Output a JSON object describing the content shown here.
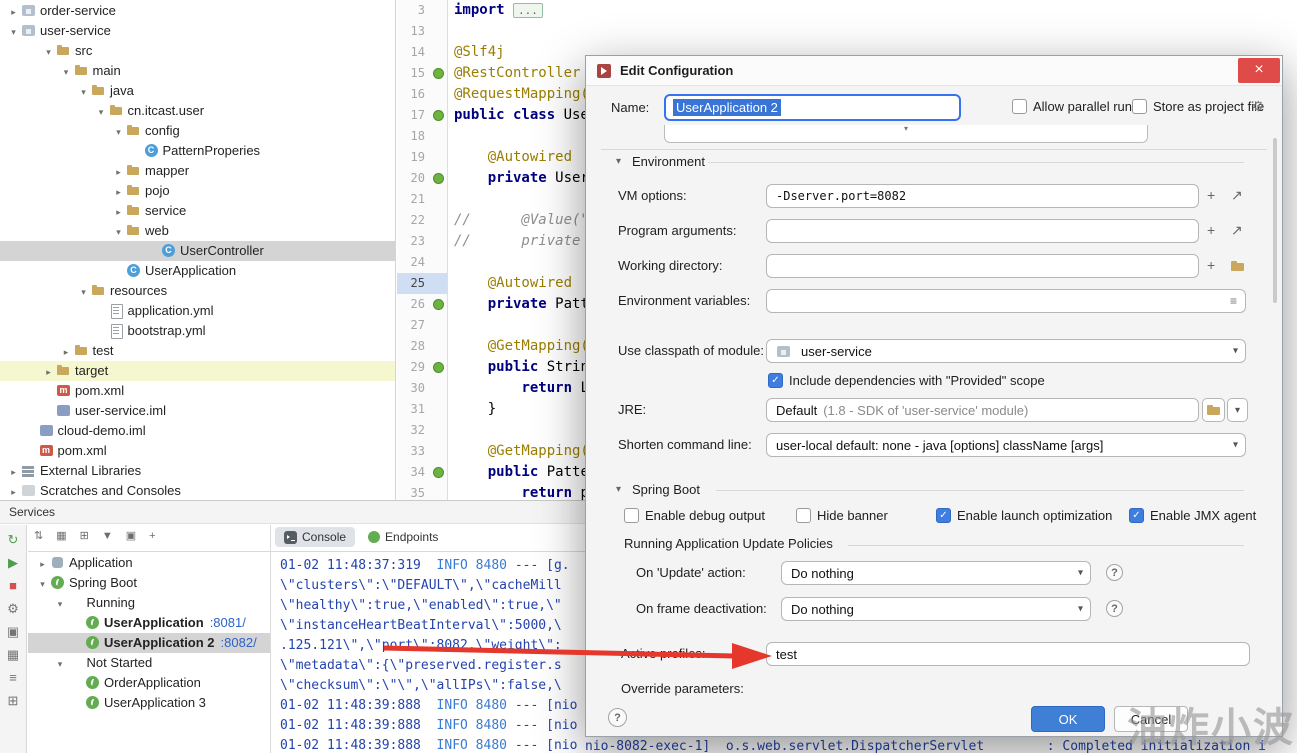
{
  "watermark": "油炸小波",
  "project_tree": {
    "items": [
      {
        "depth": 0,
        "chevron": ">",
        "icon": "module",
        "label": "order-service"
      },
      {
        "depth": 0,
        "chevron": "v",
        "icon": "module",
        "label": "user-service"
      },
      {
        "depth": 2,
        "chevron": "v",
        "icon": "folder",
        "label": "src"
      },
      {
        "depth": 3,
        "chevron": "v",
        "icon": "folder",
        "label": "main"
      },
      {
        "depth": 4,
        "chevron": "v",
        "icon": "folder",
        "label": "java"
      },
      {
        "depth": 5,
        "chevron": "v",
        "icon": "package",
        "label": "cn.itcast.user"
      },
      {
        "depth": 6,
        "chevron": "v",
        "icon": "folder",
        "label": "config"
      },
      {
        "depth": 7,
        "chevron": "",
        "icon": "class",
        "label": "PatternProperies"
      },
      {
        "depth": 6,
        "chevron": ">",
        "icon": "folder",
        "label": "mapper"
      },
      {
        "depth": 6,
        "chevron": ">",
        "icon": "folder",
        "label": "pojo"
      },
      {
        "depth": 6,
        "chevron": ">",
        "icon": "folder",
        "label": "service"
      },
      {
        "depth": 6,
        "chevron": "v",
        "icon": "folder",
        "label": "web"
      },
      {
        "depth": 8,
        "chevron": "",
        "icon": "class",
        "label": "UserController",
        "selected": true
      },
      {
        "depth": 6,
        "chevron": "",
        "icon": "class",
        "label": "UserApplication"
      },
      {
        "depth": 4,
        "chevron": "v",
        "icon": "folder",
        "label": "resources"
      },
      {
        "depth": 5,
        "chevron": "",
        "icon": "yml",
        "label": "application.yml"
      },
      {
        "depth": 5,
        "chevron": "",
        "icon": "yml",
        "label": "bootstrap.yml"
      },
      {
        "depth": 3,
        "chevron": ">",
        "icon": "folder",
        "label": "test"
      },
      {
        "depth": 2,
        "chevron": ">",
        "icon": "folder",
        "label": "target",
        "highlight": true
      },
      {
        "depth": 2,
        "chevron": "",
        "icon": "maven",
        "label": "pom.xml"
      },
      {
        "depth": 2,
        "chevron": "",
        "icon": "iml",
        "label": "user-service.iml"
      },
      {
        "depth": 1,
        "chevron": "",
        "icon": "iml",
        "label": "cloud-demo.iml"
      },
      {
        "depth": 1,
        "chevron": "",
        "icon": "maven",
        "label": "pom.xml"
      },
      {
        "depth": 0,
        "chevron": ">",
        "icon": "lib",
        "label": "External Libraries"
      },
      {
        "depth": 0,
        "chevron": ">",
        "icon": "scratch",
        "label": "Scratches and Consoles"
      }
    ]
  },
  "editor": {
    "lines": [
      {
        "num": "3",
        "gutter": false,
        "parts": [
          {
            "t": "import ",
            "c": "k"
          },
          {
            "t": "...",
            "c": "fold"
          }
        ]
      },
      {
        "num": "13",
        "gutter": false,
        "parts": []
      },
      {
        "num": "14",
        "gutter": false,
        "parts": [
          {
            "t": "@Slf4j",
            "c": "a"
          }
        ]
      },
      {
        "num": "15",
        "gutter": true,
        "parts": [
          {
            "t": "@RestController",
            "c": "a"
          }
        ]
      },
      {
        "num": "16",
        "gutter": false,
        "parts": [
          {
            "t": "@RequestMapping(",
            "c": "a"
          }
        ]
      },
      {
        "num": "17",
        "gutter": true,
        "parts": [
          {
            "t": "public class ",
            "c": "k"
          },
          {
            "t": "Use",
            "c": "p"
          }
        ]
      },
      {
        "num": "18",
        "gutter": false,
        "parts": []
      },
      {
        "num": "19",
        "gutter": false,
        "parts": [
          {
            "t": "    ",
            "c": "p"
          },
          {
            "t": "@Autowired",
            "c": "a"
          }
        ]
      },
      {
        "num": "20",
        "gutter": true,
        "parts": [
          {
            "t": "    ",
            "c": "p"
          },
          {
            "t": "private ",
            "c": "k"
          },
          {
            "t": "User",
            "c": "p"
          }
        ]
      },
      {
        "num": "21",
        "gutter": false,
        "parts": []
      },
      {
        "num": "22",
        "gutter": false,
        "parts": [
          {
            "t": "//      @Value(\"$",
            "c": "c"
          }
        ]
      },
      {
        "num": "23",
        "gutter": false,
        "parts": [
          {
            "t": "//      private St",
            "c": "c"
          }
        ]
      },
      {
        "num": "24",
        "gutter": false,
        "parts": []
      },
      {
        "num": "25",
        "gutter": false,
        "cur": true,
        "parts": [
          {
            "t": "    ",
            "c": "p"
          },
          {
            "t": "@Autowired",
            "c": "a"
          }
        ]
      },
      {
        "num": "26",
        "gutter": true,
        "parts": [
          {
            "t": "    ",
            "c": "p"
          },
          {
            "t": "private ",
            "c": "k"
          },
          {
            "t": "Patt",
            "c": "p"
          }
        ]
      },
      {
        "num": "27",
        "gutter": false,
        "parts": []
      },
      {
        "num": "28",
        "gutter": false,
        "parts": [
          {
            "t": "    ",
            "c": "p"
          },
          {
            "t": "@GetMapping(",
            "c": "a"
          }
        ]
      },
      {
        "num": "29",
        "gutter": true,
        "parts": [
          {
            "t": "    ",
            "c": "p"
          },
          {
            "t": "public ",
            "c": "k"
          },
          {
            "t": "Strin",
            "c": "p"
          }
        ]
      },
      {
        "num": "30",
        "gutter": false,
        "parts": [
          {
            "t": "        ",
            "c": "p"
          },
          {
            "t": "return ",
            "c": "k"
          },
          {
            "t": "L",
            "c": "p"
          }
        ]
      },
      {
        "num": "31",
        "gutter": false,
        "parts": [
          {
            "t": "    }",
            "c": "p"
          }
        ]
      },
      {
        "num": "32",
        "gutter": false,
        "parts": []
      },
      {
        "num": "33",
        "gutter": false,
        "parts": [
          {
            "t": "    ",
            "c": "p"
          },
          {
            "t": "@GetMapping(",
            "c": "a"
          }
        ]
      },
      {
        "num": "34",
        "gutter": true,
        "parts": [
          {
            "t": "    ",
            "c": "p"
          },
          {
            "t": "public ",
            "c": "k"
          },
          {
            "t": "Patte",
            "c": "p"
          }
        ]
      },
      {
        "num": "35",
        "gutter": false,
        "parts": [
          {
            "t": "        ",
            "c": "p"
          },
          {
            "t": "return ",
            "c": "k"
          },
          {
            "t": "p",
            "c": "p"
          }
        ]
      }
    ]
  },
  "services": {
    "header": "Services",
    "console_tab": "Console",
    "endpoints_tab": "Endpoints",
    "left_toolbar": [
      {
        "name": "rerun-icon",
        "glyph": "↻",
        "color": "#4f9e4f"
      },
      {
        "name": "run-icon",
        "glyph": "▶",
        "color": "#4f9e4f"
      },
      {
        "name": "stop-icon",
        "glyph": "■",
        "color": "#d25252"
      },
      {
        "name": "settings-icon",
        "glyph": "⚙",
        "color": "#757575"
      },
      {
        "name": "thread-dump-icon",
        "glyph": "▣",
        "color": "#757575"
      },
      {
        "name": "layout-icon",
        "glyph": "▦",
        "color": "#757575"
      },
      {
        "name": "options-icon",
        "glyph": "≡",
        "color": "#757575"
      },
      {
        "name": "grid-icon",
        "glyph": "⊞",
        "color": "#757575"
      }
    ],
    "top_toolbar": [
      {
        "name": "expand-all-icon",
        "glyph": "⇅"
      },
      {
        "name": "group-icon",
        "glyph": "▦"
      },
      {
        "name": "view-options-icon",
        "glyph": "⊞"
      },
      {
        "name": "filter-icon",
        "glyph": "▼"
      },
      {
        "name": "layout-icon",
        "glyph": "▣"
      },
      {
        "name": "add-service-icon",
        "glyph": "+"
      }
    ],
    "tree": [
      {
        "depth": 0,
        "chevron": ">",
        "icon": "app",
        "label": "Application"
      },
      {
        "depth": 0,
        "chevron": "v",
        "icon": "spring",
        "label": "Spring Boot"
      },
      {
        "depth": 1,
        "chevron": "v",
        "icon": "",
        "label": "Running"
      },
      {
        "depth": 2,
        "chevron": "",
        "icon": "springrun",
        "label": "UserApplication",
        "suffix": ":8081/",
        "bold": true
      },
      {
        "depth": 2,
        "chevron": "",
        "icon": "springrun",
        "label": "UserApplication 2",
        "suffix": ":8082/",
        "bold": true,
        "selected": true
      },
      {
        "depth": 1,
        "chevron": "v",
        "icon": "",
        "label": "Not Started"
      },
      {
        "depth": 2,
        "chevron": "",
        "icon": "springrun",
        "label": "OrderApplication"
      },
      {
        "depth": 2,
        "chevron": "",
        "icon": "springrun",
        "label": "UserApplication 3"
      }
    ]
  },
  "console": {
    "lines": [
      [
        {
          "t": "01-02 11:48:37:319  ",
          "c": "ts"
        },
        {
          "t": "INFO 8480",
          "c": "info"
        },
        {
          "t": " --- [g.",
          "c": "ts"
        }
      ],
      [
        {
          "t": "\\\"clusters\\\":\\\"DEFAULT\\\",\\\"cacheMill",
          "c": "ts"
        }
      ],
      [
        {
          "t": "\\\"healthy\\\":true,\\\"enabled\\\":true,\\\"",
          "c": "ts"
        }
      ],
      [
        {
          "t": "\\\"instanceHeartBeatInterval\\\":5000,\\",
          "c": "ts"
        }
      ],
      [
        {
          "t": ".125.121\\\",\\\"port\\\":8082,\\\"weight\\\":",
          "c": "ts"
        }
      ],
      [
        {
          "t": "\\\"metadata\\\":{\\\"preserved.register.s",
          "c": "ts"
        }
      ],
      [
        {
          "t": "\\\"checksum\\\":\\\"\\\",\\\"allIPs\\\":false,\\",
          "c": "ts"
        }
      ],
      [
        {
          "t": "01-02 11:48:39:888  ",
          "c": "ts"
        },
        {
          "t": "INFO 8480",
          "c": "info"
        },
        {
          "t": " --- [nio",
          "c": "ts"
        }
      ],
      [
        {
          "t": "01-02 11:48:39:888  ",
          "c": "ts"
        },
        {
          "t": "INFO 8480",
          "c": "info"
        },
        {
          "t": " --- [nio",
          "c": "ts"
        }
      ],
      [
        {
          "t": "01-02 11:48:39:888  ",
          "c": "ts"
        },
        {
          "t": "INFO 8480",
          "c": "info"
        },
        {
          "t": " --- [nio",
          "c": "ts"
        }
      ]
    ],
    "bottom_line": "nio-8082-exec-1]  o.s.web.servlet.DispatcherServlet        : Completed initialization i"
  },
  "dialog": {
    "title": "Edit Configuration",
    "name_label": "Name:",
    "name_value": "UserApplication 2",
    "allow_parallel_run": "Allow parallel run",
    "store_as_project_file": "Store as project file",
    "env_section": "Environment",
    "vm_options_label": "VM options:",
    "vm_options_value": "-Dserver.port=8082",
    "program_arguments_label": "Program arguments:",
    "working_directory_label": "Working directory:",
    "environment_variables_label": "Environment variables:",
    "use_classpath_label": "Use classpath of module:",
    "use_classpath_value": "user-service",
    "provided_scope_label": "Include dependencies with \"Provided\" scope",
    "jre_label": "JRE:",
    "jre_value": "Default",
    "jre_detail": " (1.8 - SDK of 'user-service' module)",
    "shorten_label": "Shorten command line:",
    "shorten_value": "user-local default: none - java [options] className [args]",
    "spring_section": "Spring Boot",
    "spring_checkboxes": [
      {
        "label": "Enable debug output",
        "checked": false
      },
      {
        "label": "Hide banner",
        "checked": false
      },
      {
        "label": "Enable launch optimization",
        "checked": true
      },
      {
        "label": "Enable JMX agent",
        "checked": true
      }
    ],
    "update_policies_title": "Running Application Update Policies",
    "on_update_label": "On 'Update' action:",
    "on_update_value": "Do nothing",
    "on_frame_label": "On frame deactivation:",
    "on_frame_value": "Do nothing",
    "active_profiles_label": "Active profiles:",
    "active_profiles_value": "test",
    "override_parameters_label": "Override parameters:",
    "ok": "OK",
    "cancel": "Cancel"
  }
}
